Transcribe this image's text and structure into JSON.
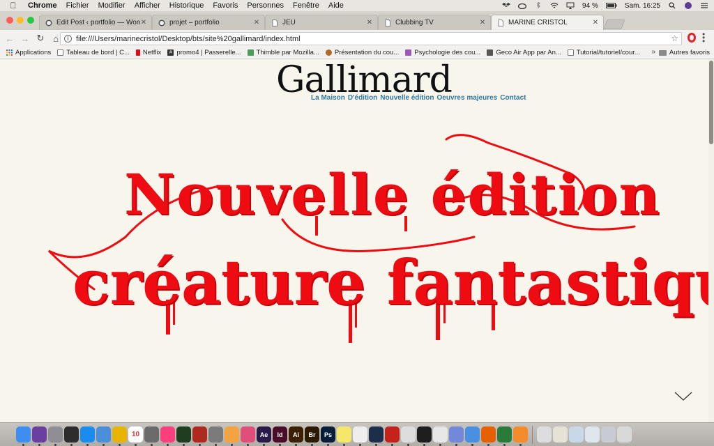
{
  "menubar": {
    "app_name": "Chrome",
    "items": [
      "Fichier",
      "Modifier",
      "Afficher",
      "Historique",
      "Favoris",
      "Personnes",
      "Fenêtre",
      "Aide"
    ],
    "battery": "94 %",
    "clock": "Sam. 16:25",
    "user": "marine"
  },
  "tabs": [
    {
      "title": "Edit Post ‹ portfolio — WordPr",
      "icon": "wordpress-icon"
    },
    {
      "title": "projet – portfolio",
      "icon": "wordpress-icon"
    },
    {
      "title": "JEU",
      "icon": "page-icon"
    },
    {
      "title": "Clubbing TV",
      "icon": "page-icon"
    },
    {
      "title": "MARINE CRISTOL",
      "icon": "page-icon",
      "active": true
    }
  ],
  "toolbar": {
    "url": "file:///Users/marinecristol/Desktop/bts/site%20gallimard/index.html"
  },
  "bookmarks": {
    "items": [
      {
        "label": "Applications",
        "icon": "apps-grid-icon",
        "color": "#d34836"
      },
      {
        "label": "Tableau de bord | C...",
        "icon": "page-icon",
        "color": "#777777"
      },
      {
        "label": "Netflix",
        "icon": "netflix-icon",
        "color": "#e50914"
      },
      {
        "label": "promo4 | Passerelle...",
        "icon": "hash-icon",
        "color": "#333333"
      },
      {
        "label": "Thimble par Mozilla...",
        "icon": "thimble-icon",
        "color": "#4a9d5b"
      },
      {
        "label": "Présentation du cou...",
        "icon": "course-icon",
        "color": "#b06a2c"
      },
      {
        "label": "Psychologie des cou...",
        "icon": "psy-icon",
        "color": "#9b59b6"
      },
      {
        "label": "Geco Air App par An...",
        "icon": "geco-icon",
        "color": "#555555"
      },
      {
        "label": "Tutorial/tutoriel/cour...",
        "icon": "page-icon",
        "color": "#777777"
      }
    ],
    "more": "»",
    "folder_label": "Autres favoris"
  },
  "site": {
    "brand": "Gallimard",
    "nav": [
      "La Maison",
      "D'édition",
      "Nouvelle édition",
      "Oeuvres majeures",
      "Contact"
    ],
    "hero_line1": "Nouvelle édition",
    "hero_line2": "créature fantastique",
    "accent_color": "#ee0c12",
    "nav_color": "#2f78a0"
  },
  "dock": {
    "items": [
      {
        "name": "finder-icon",
        "color": "#3d8ef0"
      },
      {
        "name": "siri-icon",
        "color": "#6b3fa0"
      },
      {
        "name": "launchpad-icon",
        "color": "#8e8e93"
      },
      {
        "name": "mission-control-icon",
        "color": "#2d2d2d"
      },
      {
        "name": "app-store-icon",
        "color": "#1a8cf0"
      },
      {
        "name": "preview-icon",
        "color": "#4a90d9"
      },
      {
        "name": "chrome-icon",
        "color": "#e8b400"
      },
      {
        "name": "calendar-icon",
        "color": "#ffffff"
      },
      {
        "name": "pocket-icon",
        "color": "#6b6b6b"
      },
      {
        "name": "itunes-icon",
        "color": "#fb3f7d"
      },
      {
        "name": "activity-monitor-icon",
        "color": "#1f3d1f"
      },
      {
        "name": "photo-booth-icon",
        "color": "#b0291e"
      },
      {
        "name": "system-preferences-icon",
        "color": "#7b7b7b"
      },
      {
        "name": "photos-icon",
        "color": "#f4a340"
      },
      {
        "name": "keynote-icon",
        "color": "#e04e7c"
      },
      {
        "name": "after-effects-icon",
        "color": "#2a1a4a"
      },
      {
        "name": "indesign-icon",
        "color": "#4a0b28"
      },
      {
        "name": "illustrator-icon",
        "color": "#3c1f00"
      },
      {
        "name": "bridge-icon",
        "color": "#2b1900"
      },
      {
        "name": "photoshop-icon",
        "color": "#061e3a"
      },
      {
        "name": "stickies-icon",
        "color": "#f5e76a"
      },
      {
        "name": "textedit-icon",
        "color": "#eeeeee"
      },
      {
        "name": "cinema4d-icon",
        "color": "#1c2e4a"
      },
      {
        "name": "filezilla-icon",
        "color": "#c6221c"
      },
      {
        "name": "preview-doc-icon",
        "color": "#dddddd"
      },
      {
        "name": "terminal-icon",
        "color": "#1e1e1e"
      },
      {
        "name": "sublime-s-icon",
        "color": "#e7e7e7"
      },
      {
        "name": "discord-icon",
        "color": "#7289da"
      },
      {
        "name": "messages-icon",
        "color": "#4a90e2"
      },
      {
        "name": "firefox-icon",
        "color": "#e66000"
      },
      {
        "name": "atom-icon",
        "color": "#2a7a3a"
      },
      {
        "name": "sublime-text-icon",
        "color": "#f48c2a"
      },
      {
        "name": "window-thumb-1-icon",
        "color": "#dddddd"
      },
      {
        "name": "window-thumb-2-icon",
        "color": "#e6e2d6"
      },
      {
        "name": "window-thumb-3-icon",
        "color": "#c8d8e8"
      },
      {
        "name": "window-thumb-4-icon",
        "color": "#dfe6ee"
      },
      {
        "name": "downloads-icon",
        "color": "#c7ccd3"
      },
      {
        "name": "trash-icon",
        "color": "#d9d9d9"
      }
    ],
    "labels": {
      "after-effects-icon": "Ae",
      "indesign-icon": "Id",
      "illustrator-icon": "Ai",
      "bridge-icon": "Br",
      "photoshop-icon": "Ps",
      "calendar-icon": "10"
    }
  }
}
